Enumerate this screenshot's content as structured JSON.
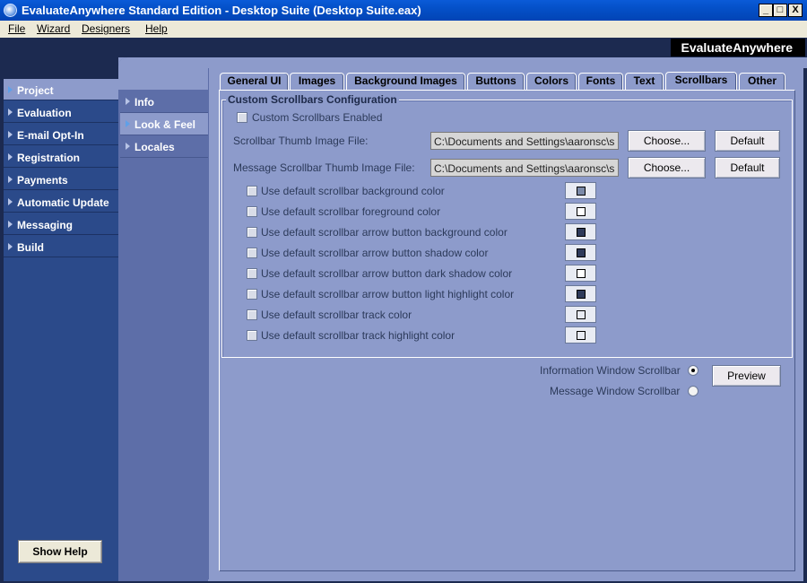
{
  "window": {
    "title": "EvaluateAnywhere Standard Edition - Desktop Suite (Desktop Suite.eax)",
    "min": "_",
    "max": "□",
    "close": "X"
  },
  "menu": [
    "File",
    "Wizard",
    "Designers",
    "Help"
  ],
  "brand": "EvaluateAnywhere",
  "left_nav": [
    "Project",
    "Evaluation",
    "E-mail Opt-In",
    "Registration",
    "Payments",
    "Automatic Update",
    "Messaging",
    "Build"
  ],
  "sub_nav": [
    "Info",
    "Look & Feel",
    "Locales"
  ],
  "tabs": [
    "General UI",
    "Images",
    "Background Images",
    "Buttons",
    "Colors",
    "Fonts",
    "Text",
    "Scrollbars",
    "Other"
  ],
  "group_title": "Custom Scrollbars Configuration",
  "enabled_label": "Custom Scrollbars Enabled",
  "thumb_label": "Scrollbar Thumb Image File:",
  "thumb_value": "C:\\Documents and Settings\\aaronsc\\s",
  "msg_thumb_label": "Message Scrollbar Thumb Image File:",
  "msg_thumb_value": "C:\\Documents and Settings\\aaronsc\\s",
  "choose_label": "Choose...",
  "default_label": "Default",
  "color_options": [
    {
      "label": "Use default scrollbar background color",
      "color": "#7b8aa8"
    },
    {
      "label": "Use default scrollbar foreground color",
      "color": "#ffffff"
    },
    {
      "label": "Use default scrollbar arrow button background color",
      "color": "#2e3a5a"
    },
    {
      "label": "Use default scrollbar arrow button shadow color",
      "color": "#2e3a5a"
    },
    {
      "label": "Use default scrollbar arrow button dark shadow color",
      "color": "#ffffff"
    },
    {
      "label": "Use default scrollbar arrow button light highlight color",
      "color": "#2e3a5a"
    },
    {
      "label": "Use default scrollbar track color",
      "color": "#e8ebf3"
    },
    {
      "label": "Use default scrollbar track highlight color",
      "color": "#e8ebf3"
    }
  ],
  "info_window_label": "Information Window Scrollbar",
  "message_window_label": "Message Window Scrollbar",
  "preview_label": "Preview",
  "show_help_label": "Show Help"
}
